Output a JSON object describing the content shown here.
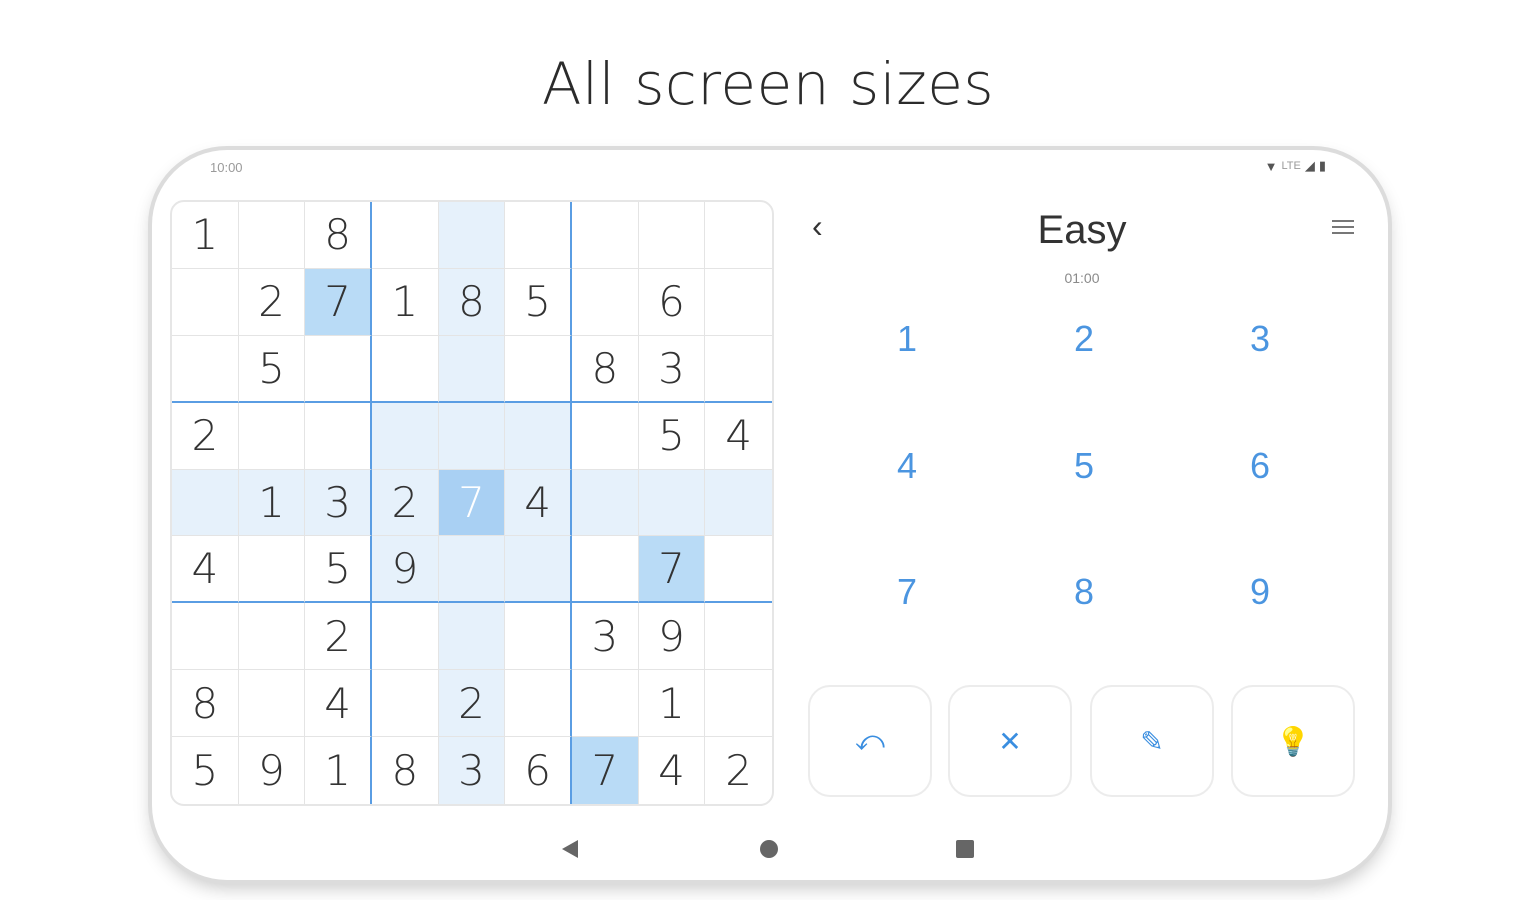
{
  "headline": "All screen sizes",
  "status": {
    "time": "10:00",
    "network": "LTE"
  },
  "header": {
    "level": "Easy",
    "timer": "01:00"
  },
  "board": [
    [
      "1",
      "",
      "8",
      "",
      "",
      "",
      "",
      "",
      ""
    ],
    [
      "",
      "2",
      "7",
      "1",
      "8",
      "5",
      "",
      "6",
      ""
    ],
    [
      "",
      "5",
      "",
      "",
      "",
      "",
      "8",
      "3",
      ""
    ],
    [
      "2",
      "",
      "",
      "",
      "",
      "",
      "",
      "5",
      "4"
    ],
    [
      "",
      "1",
      "3",
      "2",
      "7",
      "4",
      "",
      "",
      ""
    ],
    [
      "4",
      "",
      "5",
      "9",
      "",
      "",
      "",
      "7",
      ""
    ],
    [
      "",
      "",
      "2",
      "",
      "",
      "",
      "3",
      "9",
      ""
    ],
    [
      "8",
      "",
      "4",
      "",
      "2",
      "",
      "",
      "1",
      ""
    ],
    [
      "5",
      "9",
      "1",
      "8",
      "3",
      "6",
      "7",
      "4",
      "2"
    ]
  ],
  "selected_cell": {
    "row": 5,
    "col": 5,
    "value": "7"
  },
  "numpad": [
    "1",
    "2",
    "3",
    "4",
    "5",
    "6",
    "7",
    "8",
    "9"
  ],
  "actions": [
    {
      "name": "undo",
      "icon": "undo-icon",
      "glyph": "⤺"
    },
    {
      "name": "erase",
      "icon": "close-icon",
      "glyph": "✕"
    },
    {
      "name": "notes",
      "icon": "pencil-off-icon",
      "glyph": "✎"
    },
    {
      "name": "hint",
      "icon": "lightbulb-icon",
      "glyph": "💡"
    }
  ],
  "colors": {
    "accent": "#4b95e0",
    "highlight": "#e6f1fb",
    "same_number": "#b9dbf6",
    "selected": "#a9d0f3"
  }
}
